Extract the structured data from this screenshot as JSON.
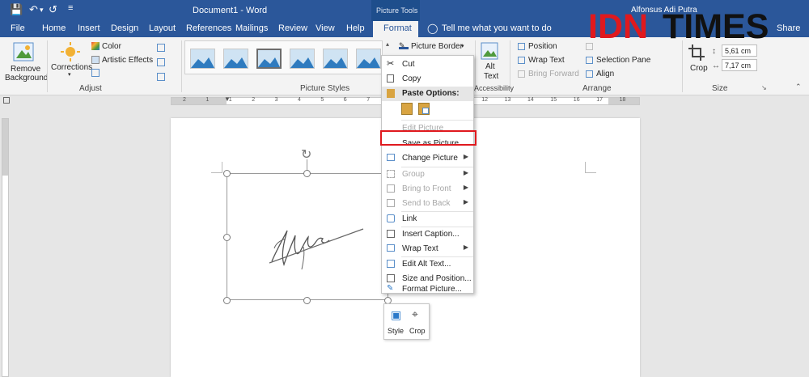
{
  "window": {
    "title": "Document1 - Word",
    "context_tab_group": "Picture Tools",
    "user": "Alfonsus Adi Putra"
  },
  "tabs": [
    "File",
    "Home",
    "Insert",
    "Design",
    "Layout",
    "References",
    "Mailings",
    "Review",
    "View",
    "Help",
    "Format"
  ],
  "tell_me": "Tell me what you want to do",
  "share": "Share",
  "ribbon": {
    "remove_background": "Remove",
    "remove_background2": "Background",
    "corrections": "Corrections",
    "color": "Color",
    "artistic_effects": "Artistic Effects",
    "adjust_group": "Adjust",
    "picture_styles_group": "Picture Styles",
    "picture_border": "Picture Border",
    "accessibility_group": "Accessibility",
    "alt_text1": "Alt",
    "alt_text2": "Text",
    "position": "Position",
    "wrap_text": "Wrap Text",
    "bring_forward": "Bring Forward",
    "selection_pane": "Selection Pane",
    "align": "Align",
    "arrange_group": "Arrange",
    "crop": "Crop",
    "height": "5,61 cm",
    "width": "7,17 cm",
    "size_group": "Size"
  },
  "watermark": {
    "red": "IDN",
    "black": "TIMES"
  },
  "context_menu": {
    "cut": "Cut",
    "copy": "Copy",
    "paste_options": "Paste Options:",
    "edit_picture": "Edit Picture",
    "save_as_picture": "Save as Picture...",
    "change_picture": "Change Picture",
    "group": "Group",
    "bring_to_front": "Bring to Front",
    "send_to_back": "Send to Back",
    "link": "Link",
    "insert_caption": "Insert Caption...",
    "wrap_text": "Wrap Text",
    "edit_alt_text": "Edit Alt Text...",
    "size_and_position": "Size and Position...",
    "format_picture": "Format Picture..."
  },
  "mini_toolbar": {
    "style": "Style",
    "crop": "Crop"
  },
  "ruler_numbers": [
    "2",
    "1",
    "1",
    "2",
    "3",
    "4",
    "5",
    "6",
    "7",
    "8",
    "9",
    "10",
    "11",
    "12",
    "13",
    "14",
    "15",
    "16",
    "17",
    "18"
  ],
  "colors": {
    "brand": "#2b579a",
    "highlight": "#e0191e"
  }
}
